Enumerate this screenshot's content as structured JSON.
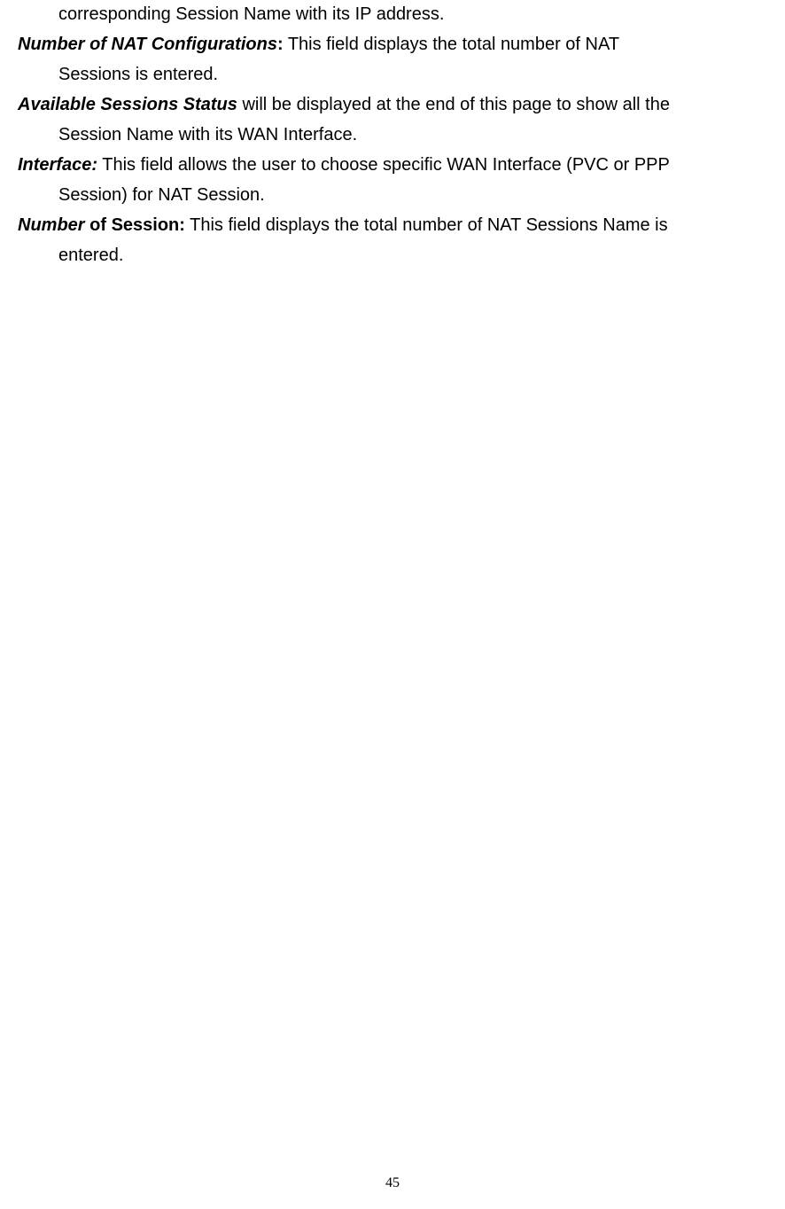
{
  "line1_indented": "corresponding Session Name with its IP address.",
  "para2_term": "Number of NAT Configurations",
  "para2_colon": ":",
  "para2_rest": " This field displays the total number of NAT",
  "para2_line2": "Sessions is entered.",
  "para3_term": "Available Sessions Status",
  "para3_rest": " will be displayed at the end of this page to show all the",
  "para3_line2": "Session Name with its WAN Interface.",
  "para4_term": "Interface:",
  "para4_rest": " This field allows the user to choose specific WAN Interface (PVC or PPP",
  "para4_line2": "Session) for NAT Session.",
  "para5_term_italic": "Number",
  "para5_term_bold": " of Session:",
  "para5_rest": " This field displays the total number of NAT Sessions Name is",
  "para5_line2": "entered.",
  "page_number": "45"
}
